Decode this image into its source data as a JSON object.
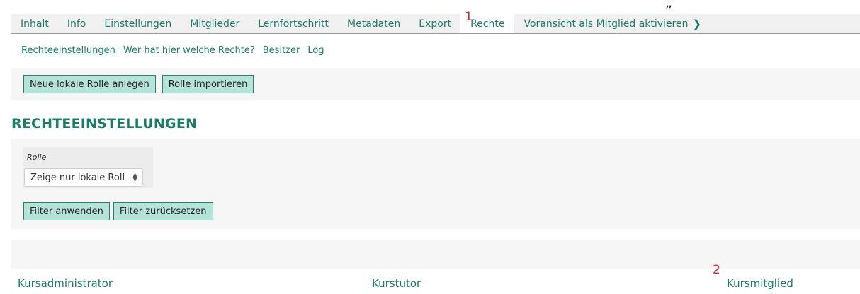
{
  "cropped_text_fragment": "„",
  "tabs": [
    {
      "label": "Inhalt",
      "active": false
    },
    {
      "label": "Info",
      "active": false
    },
    {
      "label": "Einstellungen",
      "active": false
    },
    {
      "label": "Mitglieder",
      "active": false
    },
    {
      "label": "Lernfortschritt",
      "active": false
    },
    {
      "label": "Metadaten",
      "active": false
    },
    {
      "label": "Export",
      "active": false
    },
    {
      "label": "Rechte",
      "active": true
    },
    {
      "label": "Voransicht als Mitglied aktivieren",
      "active": false
    }
  ],
  "tab_chevron_icon": "chevron-right",
  "annotation_markers": {
    "first": "1",
    "second": "2"
  },
  "subtabs": [
    {
      "label": "Rechteeinstellungen",
      "active": true
    },
    {
      "label": "Wer hat hier welche Rechte?",
      "active": false
    },
    {
      "label": "Besitzer",
      "active": false
    },
    {
      "label": "Log",
      "active": false
    }
  ],
  "toolbar": {
    "new_role_label": "Neue lokale Rolle anlegen",
    "import_role_label": "Rolle importieren"
  },
  "page_title": "RECHTEEINSTELLUNGEN",
  "filter": {
    "label": "Rolle",
    "selected_value": "Zeige nur lokale Roll",
    "apply_label": "Filter anwenden",
    "reset_label": "Filter zurücksetzen"
  },
  "role_columns": [
    "Kursadministrator",
    "Kurstutor",
    "Kursmitglied"
  ],
  "colors": {
    "accent": "#1c7c6a",
    "button_bg": "#b6e3d8",
    "marker": "#e8232c"
  }
}
